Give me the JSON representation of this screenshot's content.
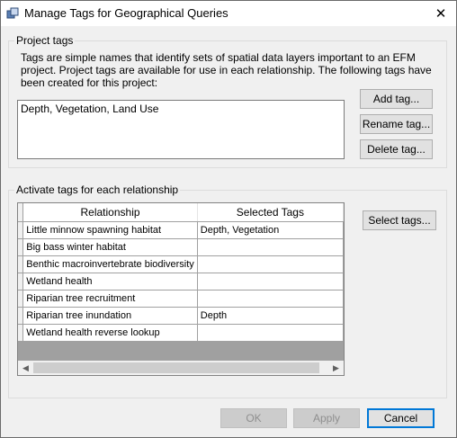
{
  "window": {
    "title": "Manage Tags for Geographical Queries",
    "icon": "app-icon",
    "close_glyph": "✕"
  },
  "project_tags": {
    "group_label": "Project tags",
    "description": "Tags are simple names that identify sets of spatial data layers important to an EFM project.  Project tags are available for use in each relationship.  The following tags have been created for this project:",
    "list_value": "Depth, Vegetation, Land Use",
    "add_label": "Add tag...",
    "rename_label": "Rename tag...",
    "delete_label": "Delete tag..."
  },
  "activate": {
    "group_label": "Activate tags for each relationship",
    "select_label": "Select tags...",
    "columns": [
      "Relationship",
      "Selected Tags"
    ],
    "rows": [
      {
        "relationship": "Little minnow spawning habitat",
        "tags": "Depth, Vegetation"
      },
      {
        "relationship": "Big bass winter habitat",
        "tags": ""
      },
      {
        "relationship": "Benthic macroinvertebrate biodiversity",
        "tags": ""
      },
      {
        "relationship": "Wetland health",
        "tags": ""
      },
      {
        "relationship": "Riparian tree recruitment",
        "tags": ""
      },
      {
        "relationship": "Riparian tree inundation",
        "tags": "Depth"
      },
      {
        "relationship": "Wetland health reverse lookup",
        "tags": ""
      }
    ],
    "scroll_left": "◀",
    "scroll_right": "▶"
  },
  "footer": {
    "ok_label": "OK",
    "apply_label": "Apply",
    "cancel_label": "Cancel"
  },
  "colors": {
    "window_bg": "#f0f0f0",
    "accent_border": "#0078d7",
    "grid_empty": "#a0a0a0"
  }
}
